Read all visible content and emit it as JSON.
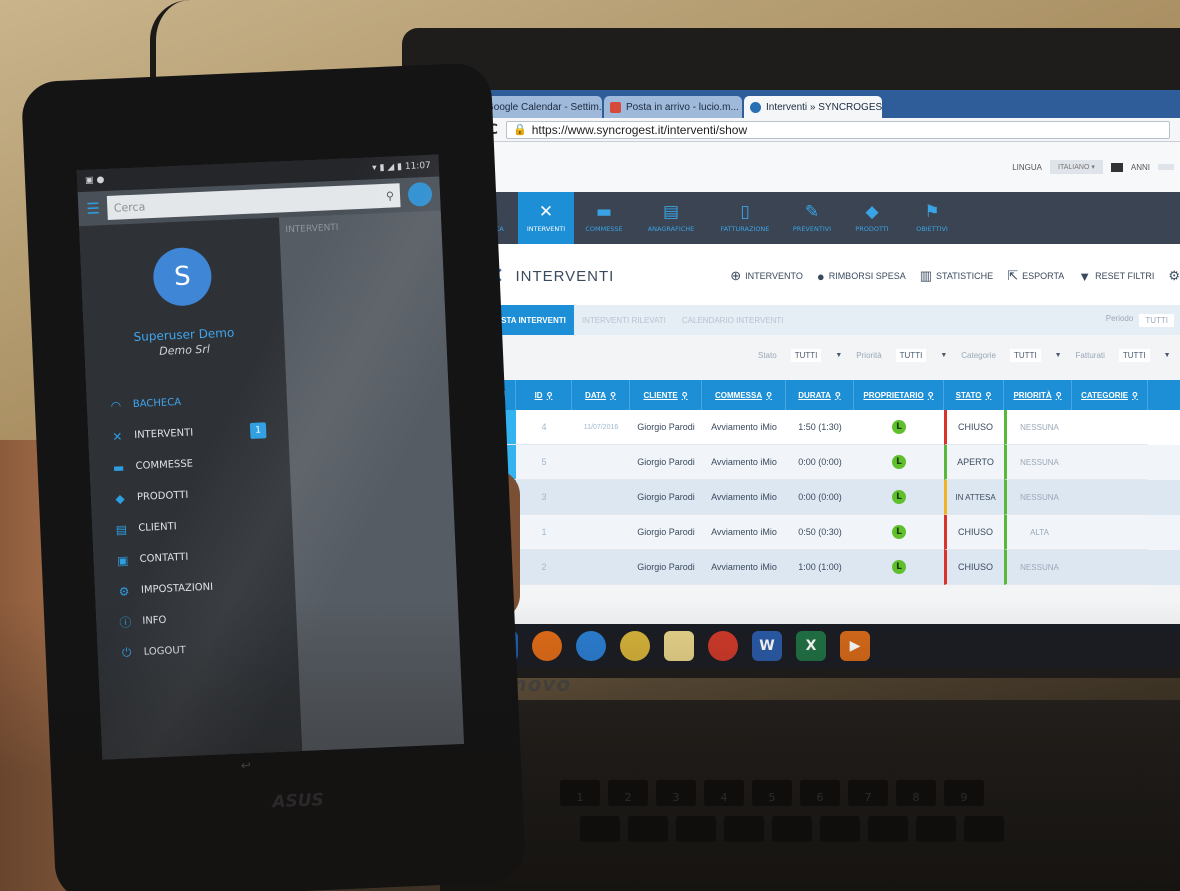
{
  "browser": {
    "tabs": [
      {
        "label": "Google Calendar - Settim...",
        "fav": "calendar-icon",
        "color": "#3a6fd8"
      },
      {
        "label": "Posta in arrivo - lucio.m...",
        "fav": "gmail-icon",
        "color": "#d64a3b"
      },
      {
        "label": "Interventi » SYNCROGEST",
        "fav": "syncrogest-icon",
        "color": "#2a6fb1"
      }
    ],
    "url": "https://www.syncrogest.it/interventi/show"
  },
  "app": {
    "lang_label": "LINGUA",
    "lang_value": "ITALIANO",
    "year_label": "ANNI",
    "nav": [
      "BACHECA",
      "INTERVENTI",
      "COMMESSE",
      "ANAGRAFICHE",
      "FATTURAZIONE",
      "PREVENTIVI",
      "PRODOTTI",
      "OBIETTIVI"
    ],
    "page_title": "INTERVENTI",
    "tools": [
      "INTERVENTO",
      "RIMBORSI SPESA",
      "STATISTICHE",
      "ESPORTA",
      "RESET FILTRI"
    ],
    "subtabs": [
      "LISTA INTERVENTI",
      "INTERVENTI RILEVATI",
      "CALENDARIO INTERVENTI"
    ],
    "period_label": "Periodo",
    "period_value": "TUTTI",
    "filters": {
      "stato_label": "Stato",
      "stato_value": "TUTTI",
      "priorita_label": "Priorità",
      "priorita_value": "TUTTI",
      "categorie_label": "Categorie",
      "categorie_value": "TUTTI",
      "fatturati_label": "Fatturati",
      "fatturati_value": "TUTTI"
    },
    "columns": [
      "ID",
      "DATA",
      "CLIENTE",
      "COMMESSA",
      "DURATA",
      "PROPRIETARIO",
      "STATO",
      "PRIORITÀ",
      "CATEGORIE"
    ],
    "rows": [
      {
        "id": "4",
        "data": "11/07/2016",
        "cliente": "Giorgio Parodi",
        "commessa": "Avviamento iMio",
        "durata": "1:50 (1:30)",
        "owner": "L",
        "stato": "CHIUSO",
        "priorita": "NESSUNA"
      },
      {
        "id": "5",
        "data": "",
        "cliente": "Giorgio Parodi",
        "commessa": "Avviamento iMio",
        "durata": "0:00 (0:00)",
        "owner": "L",
        "stato": "APERTO",
        "priorita": "NESSUNA"
      },
      {
        "id": "3",
        "data": "",
        "cliente": "Giorgio Parodi",
        "commessa": "Avviamento iMio",
        "durata": "0:00 (0:00)",
        "owner": "L",
        "stato": "IN ATTESA",
        "priorita": "NESSUNA"
      },
      {
        "id": "1",
        "data": "",
        "cliente": "Giorgio Parodi",
        "commessa": "Avviamento iMio",
        "durata": "0:50 (0:30)",
        "owner": "L",
        "stato": "CHIUSO",
        "priorita": "ALTA"
      },
      {
        "id": "2",
        "data": "",
        "cliente": "Giorgio Parodi",
        "commessa": "Avviamento iMio",
        "durata": "1:00 (1:00)",
        "owner": "L",
        "stato": "CHIUSO",
        "priorita": "NESSUNA"
      }
    ]
  },
  "laptop": {
    "brand": "lenovo"
  },
  "phone": {
    "brand": "ASUS",
    "time": "11:07",
    "search_placeholder": "Cerca",
    "bg_title": "INTERVENTI",
    "avatar_letter": "S",
    "user_name": "Superuser Demo",
    "company": "Demo Srl",
    "menu": [
      {
        "label": "BACHECA",
        "icon": "dashboard-icon"
      },
      {
        "label": "INTERVENTI",
        "icon": "wrench-icon",
        "badge": "1"
      },
      {
        "label": "COMMESSE",
        "icon": "folder-icon"
      },
      {
        "label": "PRODOTTI",
        "icon": "box-icon"
      },
      {
        "label": "CLIENTI",
        "icon": "building-icon"
      },
      {
        "label": "CONTATTI",
        "icon": "contacts-icon"
      },
      {
        "label": "IMPOSTAZIONI",
        "icon": "gear-icon"
      },
      {
        "label": "INFO",
        "icon": "info-icon"
      },
      {
        "label": "LOGOUT",
        "icon": "power-icon"
      }
    ]
  }
}
